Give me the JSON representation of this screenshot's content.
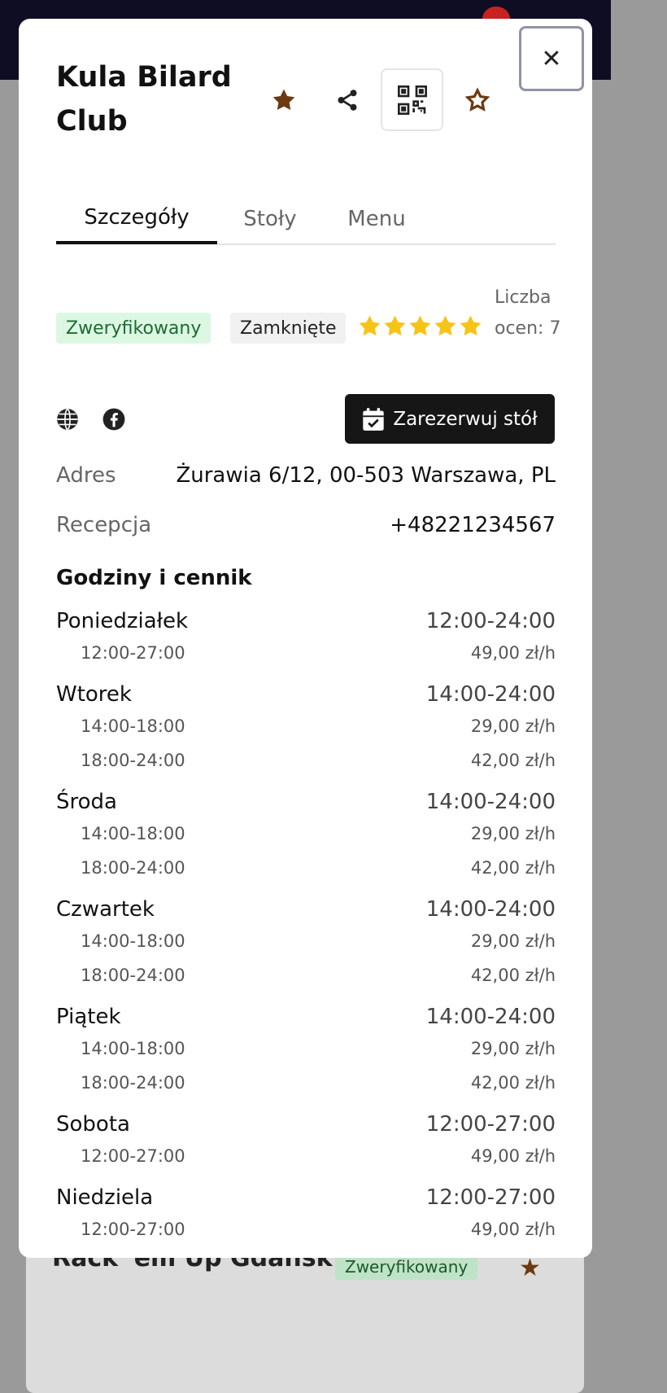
{
  "background": {
    "card_title": "Rack 'em Up Gdańsk",
    "card_badge": "Zweryfikowany"
  },
  "modal": {
    "title": "Kula Bilard Club",
    "close_label": "✕",
    "icons": {
      "favorite": "star-filled-icon",
      "share": "share-icon",
      "qr": "qr-code-icon",
      "rate": "star-outline-icon"
    },
    "tabs": [
      {
        "label": "Szczegóły",
        "active": true
      },
      {
        "label": "Stoły",
        "active": false
      },
      {
        "label": "Menu",
        "active": false
      }
    ],
    "badges": {
      "verified": "Zweryfikowany",
      "status": "Zamknięte"
    },
    "rating": {
      "stars": 5,
      "count_label": "Liczba ocen: 7"
    },
    "reserve_label": "Zarezerwuj stół",
    "address": {
      "label": "Adres",
      "value": "Żurawia 6/12, 00-503 Warszawa, PL"
    },
    "reception": {
      "label": "Recepcja",
      "value": "+48221234567"
    },
    "hours_title": "Godziny i cennik",
    "hours": [
      {
        "day": "Poniedziałek",
        "range": "12:00-24:00",
        "slots": [
          {
            "time": "12:00-27:00",
            "price": "49,00 zł/h"
          }
        ]
      },
      {
        "day": "Wtorek",
        "range": "14:00-24:00",
        "slots": [
          {
            "time": "14:00-18:00",
            "price": "29,00 zł/h"
          },
          {
            "time": "18:00-24:00",
            "price": "42,00 zł/h"
          }
        ]
      },
      {
        "day": "Środa",
        "range": "14:00-24:00",
        "slots": [
          {
            "time": "14:00-18:00",
            "price": "29,00 zł/h"
          },
          {
            "time": "18:00-24:00",
            "price": "42,00 zł/h"
          }
        ]
      },
      {
        "day": "Czwartek",
        "range": "14:00-24:00",
        "slots": [
          {
            "time": "14:00-18:00",
            "price": "29,00 zł/h"
          },
          {
            "time": "18:00-24:00",
            "price": "42,00 zł/h"
          }
        ]
      },
      {
        "day": "Piątek",
        "range": "14:00-24:00",
        "slots": [
          {
            "time": "14:00-18:00",
            "price": "29,00 zł/h"
          },
          {
            "time": "18:00-24:00",
            "price": "42,00 zł/h"
          }
        ]
      },
      {
        "day": "Sobota",
        "range": "12:00-27:00",
        "slots": [
          {
            "time": "12:00-27:00",
            "price": "49,00 zł/h"
          }
        ]
      },
      {
        "day": "Niedziela",
        "range": "12:00-27:00",
        "slots": [
          {
            "time": "12:00-27:00",
            "price": "49,00 zł/h"
          }
        ]
      }
    ]
  },
  "colors": {
    "accent_brown": "#6b3a12",
    "star_yellow": "#f6c416",
    "verified_bg": "#dcf7e2",
    "verified_text": "#1b6b34",
    "header_dark": "#0e0d24"
  }
}
